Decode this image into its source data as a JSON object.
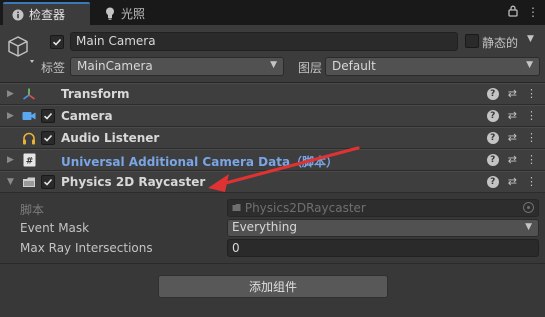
{
  "tabs": [
    {
      "label": "检查器",
      "icon": "info-icon"
    },
    {
      "label": "光照",
      "icon": "lightbulb-icon"
    }
  ],
  "tab_actions": {
    "lock_icon": "lock-icon",
    "menu_glyph": "⋮"
  },
  "header": {
    "name": "Main Camera",
    "active": true,
    "static_label": "静态的",
    "static": false,
    "tag_label": "标签",
    "tag_value": "MainCamera",
    "layer_label": "图层",
    "layer_value": "Default"
  },
  "components": [
    {
      "title": "Transform",
      "has_checkbox": false,
      "icon": "transform-axes-icon",
      "expanded": false
    },
    {
      "title": "Camera",
      "has_checkbox": true,
      "checked": true,
      "icon": "camera-icon",
      "expanded": false
    },
    {
      "title": "Audio Listener",
      "has_checkbox": true,
      "checked": true,
      "icon": "headphones-icon",
      "expanded": false
    },
    {
      "title": "Universal Additional Camera Data（脚本）",
      "has_checkbox": false,
      "icon": "script-icon",
      "expanded": false,
      "color": "#7aa5e6"
    },
    {
      "title": "Physics 2D Raycaster",
      "has_checkbox": true,
      "checked": true,
      "icon": "raycaster-icon",
      "expanded": true
    }
  ],
  "properties": {
    "script_label": "脚本",
    "script_value": "Physics2DRaycaster",
    "event_mask_label": "Event Mask",
    "event_mask_value": "Everything",
    "max_ray_label": "Max Ray Intersections",
    "max_ray_value": "0"
  },
  "add_component_label": "添加组件",
  "annotation_color": "#e03232",
  "glyphs": {
    "help": "?",
    "preset": "⇄",
    "menu": "⋮",
    "collapsed": "▶",
    "expanded": "▼",
    "dropdown": "▼"
  }
}
